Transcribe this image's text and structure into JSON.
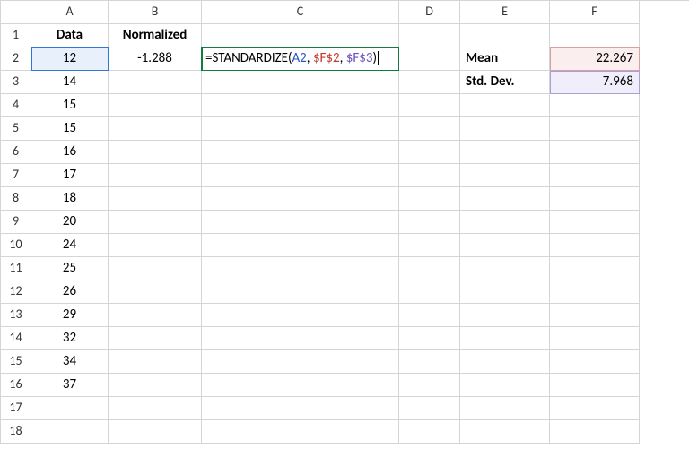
{
  "columns": [
    "A",
    "B",
    "C",
    "D",
    "E",
    "F"
  ],
  "rowCount": 18,
  "headers": {
    "A1": "Data",
    "B1": "Normalized"
  },
  "dataA": [
    "12",
    "14",
    "15",
    "15",
    "16",
    "17",
    "18",
    "20",
    "24",
    "25",
    "26",
    "29",
    "32",
    "34",
    "37"
  ],
  "B2": "-1.288",
  "formulaC2": {
    "prefix": "=STANDARDIZE(",
    "ref1": "A2",
    "sep1": ", ",
    "ref2": "$F$2",
    "sep2": ", ",
    "ref3": "$F$3",
    "suffix": ")"
  },
  "E2": "Mean",
  "E3": "Std. Dev.",
  "F2": "22.267",
  "F3": "7.968"
}
